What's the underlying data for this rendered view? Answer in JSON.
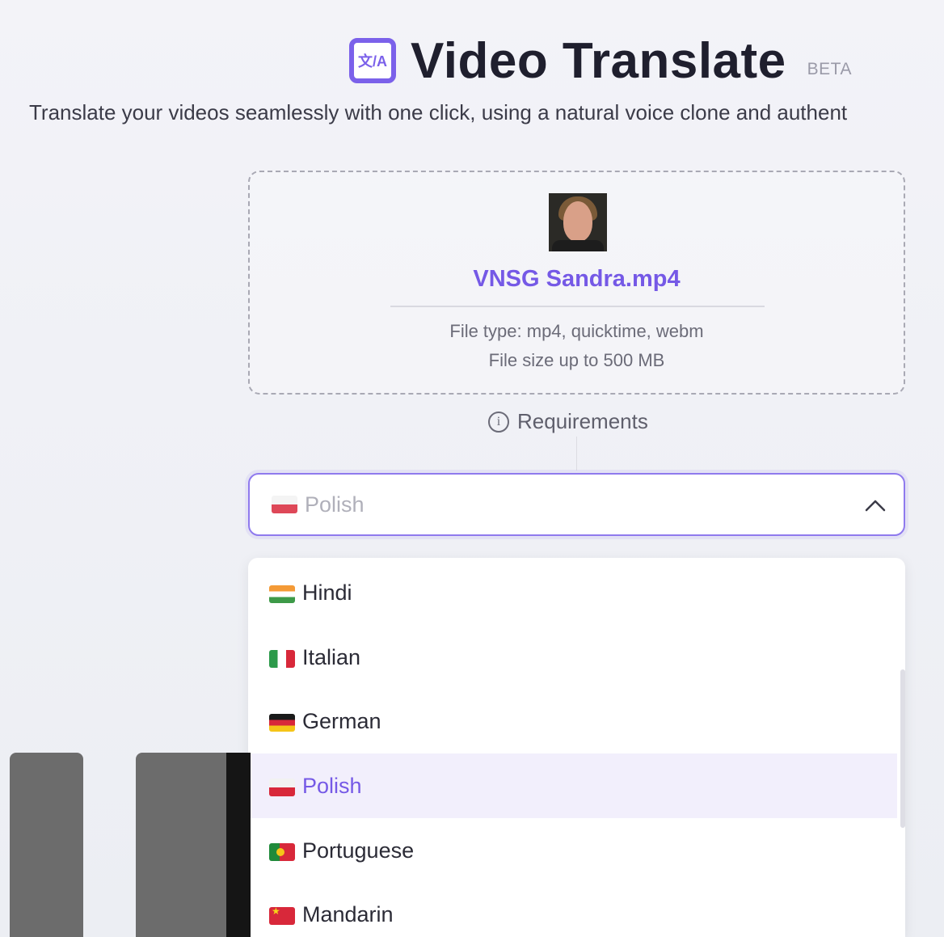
{
  "header": {
    "icon": "translate-icon",
    "icon_glyph": "文/A",
    "title": "Video Translate",
    "badge": "BETA",
    "subtitle": "Translate your videos seamlessly with one click, using a natural voice clone and authent"
  },
  "upload": {
    "file_name": "VNSG Sandra.mp4",
    "file_types": "File type: mp4, quicktime, webm",
    "file_size": "File size up to 500 MB"
  },
  "requirements": {
    "icon": "info-icon",
    "icon_glyph": "i",
    "label": "Requirements"
  },
  "language_select": {
    "selected_value": "Polish",
    "selected_flag": "flag-poland",
    "expanded": true,
    "options": [
      {
        "label": "Hindi",
        "flag": "flag-india"
      },
      {
        "label": "Italian",
        "flag": "flag-italy"
      },
      {
        "label": "German",
        "flag": "flag-germany"
      },
      {
        "label": "Polish",
        "flag": "flag-poland",
        "selected": true
      },
      {
        "label": "Portuguese",
        "flag": "flag-portugal"
      },
      {
        "label": "Mandarin",
        "flag": "flag-china"
      }
    ]
  },
  "colors": {
    "accent": "#7559e6",
    "selected_bg": "#f2effc",
    "title_text": "#1f1f2e"
  }
}
